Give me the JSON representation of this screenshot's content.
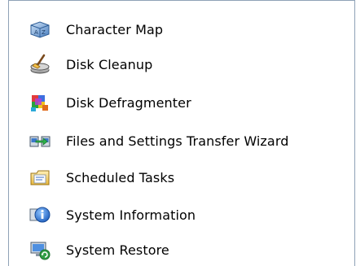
{
  "menu": {
    "items": [
      {
        "label": "Character Map",
        "icon": "character-map-icon"
      },
      {
        "label": "Disk Cleanup",
        "icon": "disk-cleanup-icon"
      },
      {
        "label": "Disk Defragmenter",
        "icon": "disk-defragmenter-icon"
      },
      {
        "label": "Files and Settings Transfer Wizard",
        "icon": "transfer-wizard-icon"
      },
      {
        "label": "Scheduled Tasks",
        "icon": "scheduled-tasks-icon"
      },
      {
        "label": "System Information",
        "icon": "system-information-icon"
      },
      {
        "label": "System Restore",
        "icon": "system-restore-icon"
      }
    ]
  },
  "colors": {
    "text": "#000000",
    "border": "#8fa2b7",
    "background": "#ffffff"
  }
}
